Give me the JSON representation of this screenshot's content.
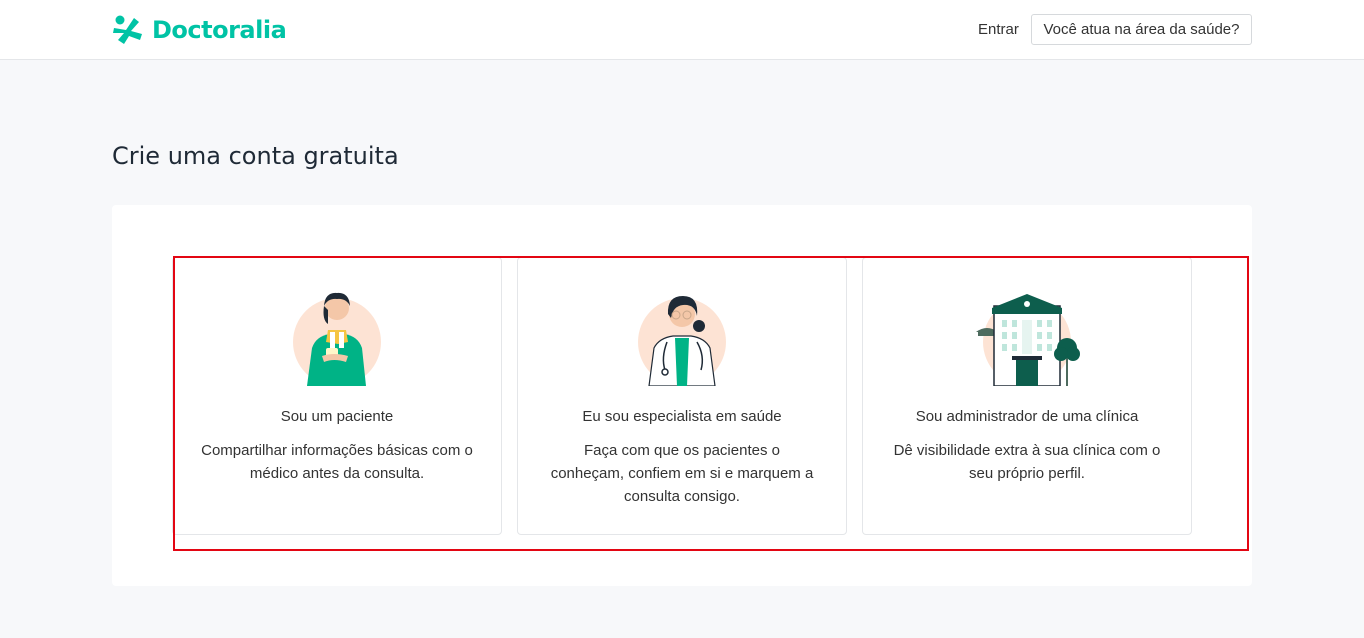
{
  "header": {
    "logo_text": "Doctoralia",
    "login_label": "Entrar",
    "pro_button_label": "Você atua na área da saúde?"
  },
  "main": {
    "title": "Crie uma conta gratuita",
    "cards": [
      {
        "icon": "patient-illustration",
        "title": "Sou um paciente",
        "description": "Compartilhar informações básicas com o médico antes da consulta."
      },
      {
        "icon": "doctor-illustration",
        "title": "Eu sou especialista em saúde",
        "description": "Faça com que os pacientes o conheçam, confiem em si e marquem a consulta consigo."
      },
      {
        "icon": "clinic-building-illustration",
        "title": "Sou administrador de uma clínica",
        "description": "Dê visibilidade extra à sua clínica com o seu próprio perfil."
      }
    ]
  },
  "colors": {
    "brand": "#00c3a5",
    "highlight": "#e30613",
    "background": "#f7f8fa"
  }
}
